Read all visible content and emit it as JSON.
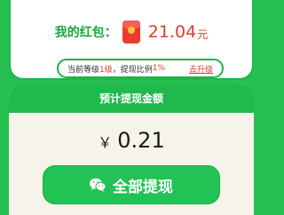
{
  "balance": {
    "label": "我的红包：",
    "amount": "21.04",
    "unit": "元",
    "icon": "red-envelope-icon"
  },
  "level": {
    "prefix": "当前等级",
    "level_value": "1级",
    "separator": "，提现比例",
    "ratio_value": "1%",
    "upgrade_label": "去升级"
  },
  "withdraw": {
    "header": "预计提现金额",
    "currency": "￥",
    "amount": "0.21",
    "button_label": "全部提现",
    "button_icon": "wechat-icon"
  },
  "colors": {
    "brand_green": "#25c050",
    "accent_red": "#e53a2c",
    "card_bg": "#f6f3ea"
  }
}
